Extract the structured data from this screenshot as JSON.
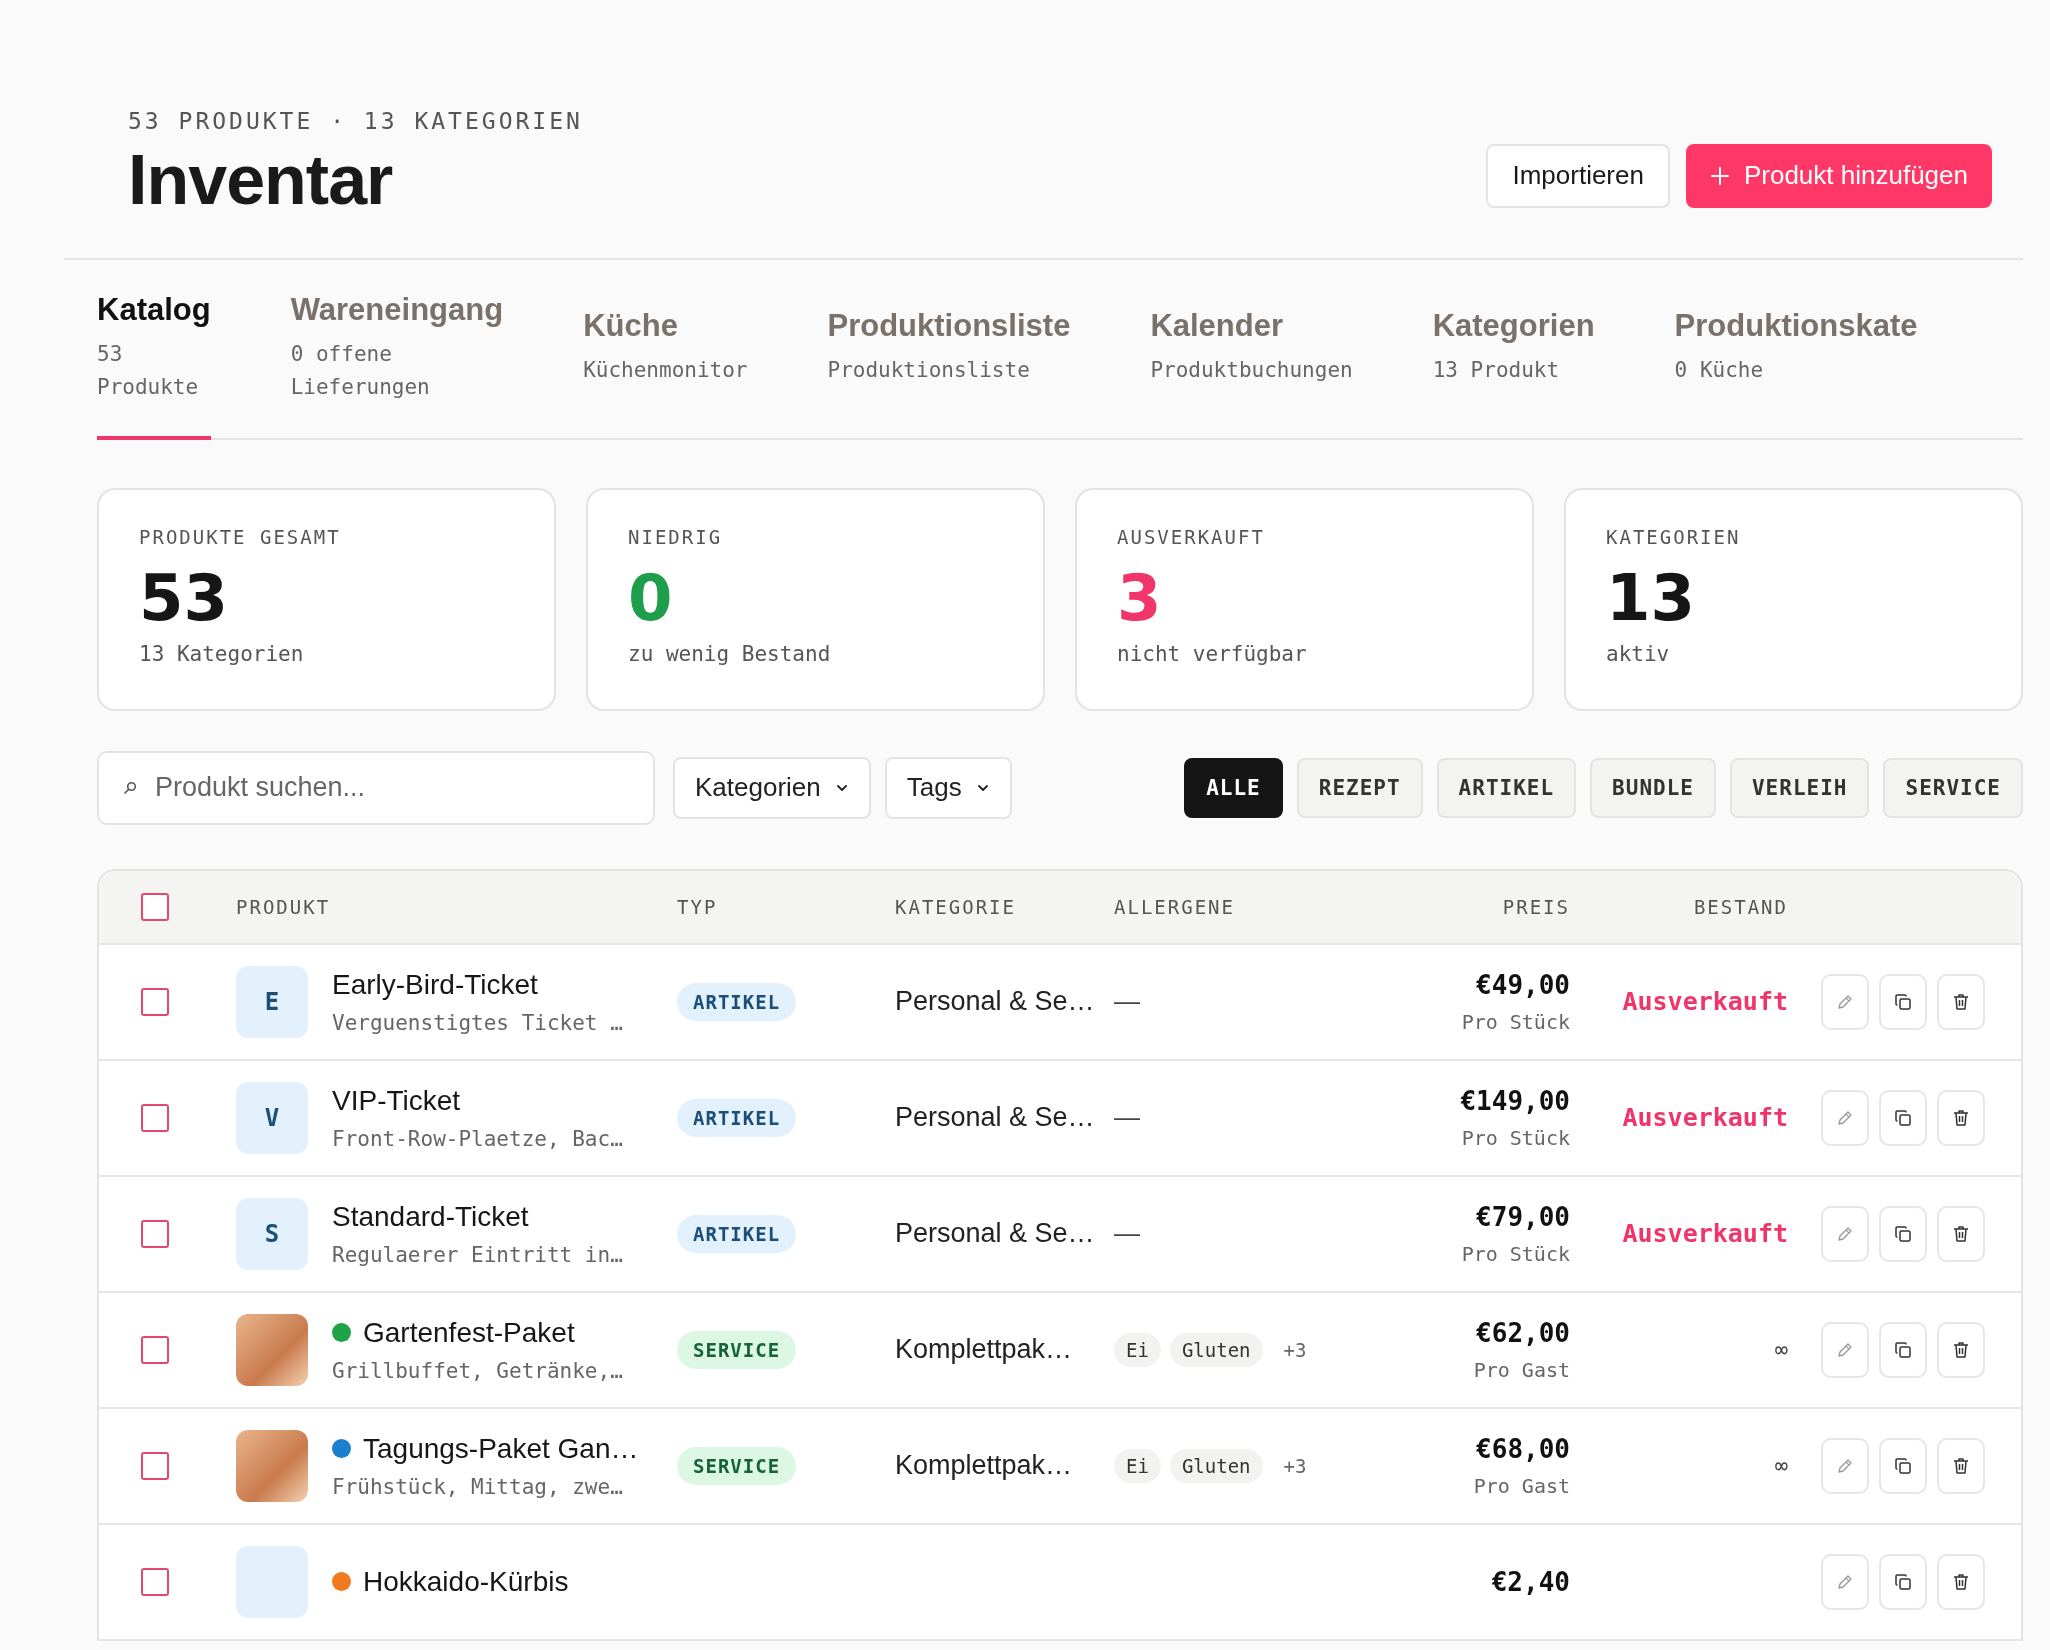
{
  "header": {
    "meta": "53 PRODUKTE · 13 KATEGORIEN",
    "title": "Inventar",
    "buttons": [
      {
        "label": "Importieren",
        "kind": "secondary"
      },
      {
        "label": "Produkt hinzufügen",
        "kind": "primary"
      }
    ]
  },
  "tabs": [
    {
      "title": "Katalog",
      "sub": "53 Produkte",
      "selected": true
    },
    {
      "title": "Wareneingang",
      "sub": "0 offene Lieferungen",
      "selected": false
    },
    {
      "title": "Küche",
      "sub": "Küchenmonitor",
      "selected": false
    },
    {
      "title": "Produktionsliste",
      "sub": "Produktionsliste",
      "selected": false
    },
    {
      "title": "Kalender",
      "sub": "Produktbuchungen",
      "selected": false
    },
    {
      "title": "Kategorien",
      "sub": "13 Produkt",
      "selected": false
    },
    {
      "title": "Produktionskate",
      "sub": "0 Küche",
      "selected": false
    }
  ],
  "stats": [
    {
      "label": "PRODUKTE GESAMT",
      "value": "53",
      "note": "13 Kategorien",
      "color": "#161616"
    },
    {
      "label": "NIEDRIG",
      "value": "0",
      "note": "zu wenig Bestand",
      "color": "#1e9e4a"
    },
    {
      "label": "AUSVERKAUFT",
      "value": "3",
      "note": "nicht verfügbar",
      "color": "#f0356a"
    },
    {
      "label": "KATEGORIEN",
      "value": "13",
      "note": "aktiv",
      "color": "#161616"
    }
  ],
  "filters": {
    "search_placeholder": "Produkt suchen...",
    "dropdowns": [
      "Kategorien",
      "Tags"
    ],
    "types": [
      {
        "label": "ALLE",
        "selected": true
      },
      {
        "label": "REZEPT",
        "selected": false
      },
      {
        "label": "ARTIKEL",
        "selected": false
      },
      {
        "label": "BUNDLE",
        "selected": false
      },
      {
        "label": "VERLEIH",
        "selected": false
      },
      {
        "label": "SERVICE",
        "selected": false
      }
    ]
  },
  "table": {
    "header_checkbox": {
      "checked": false
    },
    "columns": [
      "PRODUKT",
      "TYP",
      "KATEGORIE",
      "ALLERGENE",
      "PREIS",
      "BESTAND"
    ],
    "rows": [
      {
        "checked": false,
        "thumb": {
          "kind": "letter",
          "letter": "E"
        },
        "name": "Early-Bird-Ticket",
        "description": "Verguenstigtes Ticket …",
        "type": {
          "label": "ARTIKEL",
          "kind": "artikel"
        },
        "category": "Personal & Se…",
        "allergens_none": "—",
        "price": "€49,00",
        "unit": "Pro Stück",
        "stock": {
          "kind": "soldout",
          "text": "Ausverkauft"
        }
      },
      {
        "checked": false,
        "thumb": {
          "kind": "letter",
          "letter": "V"
        },
        "name": "VIP-Ticket",
        "description": "Front-Row-Plaetze, Bac…",
        "type": {
          "label": "ARTIKEL",
          "kind": "artikel"
        },
        "category": "Personal & Se…",
        "allergens_none": "—",
        "price": "€149,00",
        "unit": "Pro Stück",
        "stock": {
          "kind": "soldout",
          "text": "Ausverkauft"
        }
      },
      {
        "checked": false,
        "thumb": {
          "kind": "letter",
          "letter": "S"
        },
        "name": "Standard-Ticket",
        "description": "Regulaerer Eintritt in…",
        "type": {
          "label": "ARTIKEL",
          "kind": "artikel"
        },
        "category": "Personal & Se…",
        "allergens_none": "—",
        "price": "€79,00",
        "unit": "Pro Stück",
        "stock": {
          "kind": "soldout",
          "text": "Ausverkauft"
        }
      },
      {
        "checked": false,
        "thumb": {
          "kind": "photo"
        },
        "color": "#1fa347",
        "name": "Gartenfest-Paket",
        "description": "Grillbuffet, Getränke,…",
        "type": {
          "label": "SERVICE",
          "kind": "service"
        },
        "category": "Komplettpak…",
        "allergens": [
          "Ei",
          "Gluten"
        ],
        "allergens_more": "+3",
        "price": "€62,00",
        "unit": "Pro Gast",
        "stock": {
          "kind": "unlimited",
          "text": "∞"
        }
      },
      {
        "checked": false,
        "thumb": {
          "kind": "photo"
        },
        "color": "#1a7fcf",
        "name": "Tagungs-Paket Gan…",
        "description": "Frühstück, Mittag, zwe…",
        "type": {
          "label": "SERVICE",
          "kind": "service"
        },
        "category": "Komplettpak…",
        "allergens": [
          "Ei",
          "Gluten"
        ],
        "allergens_more": "+3",
        "price": "€68,00",
        "unit": "Pro Gast",
        "stock": {
          "kind": "unlimited",
          "text": "∞"
        }
      },
      {
        "checked": false,
        "thumb": {
          "kind": "letter"
        },
        "color": "#f07a1f",
        "name": "Hokkaido-Kürbis",
        "price": "€2,40"
      }
    ]
  }
}
